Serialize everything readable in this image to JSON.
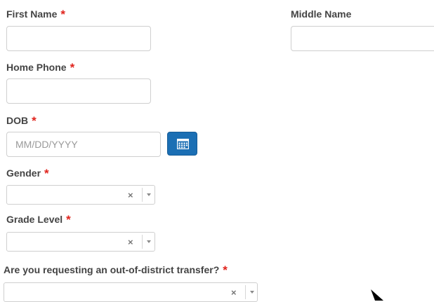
{
  "form": {
    "required_marker": "*",
    "first_name": {
      "label": "First Name",
      "value": ""
    },
    "middle_name": {
      "label": "Middle Name",
      "value": ""
    },
    "home_phone": {
      "label": "Home Phone",
      "value": ""
    },
    "dob": {
      "label": "DOB",
      "placeholder": "MM/DD/YYYY",
      "calendar_icon": "calendar-icon"
    },
    "gender": {
      "label": "Gender",
      "selected": "",
      "clear_glyph": "×"
    },
    "grade_level": {
      "label": "Grade Level",
      "selected": "",
      "clear_glyph": "×"
    },
    "transfer": {
      "label": "Are you requesting an out-of-district transfer?",
      "selected": "",
      "clear_glyph": "×"
    }
  },
  "colors": {
    "required": "#e0231c",
    "calendar_button": "#1b6fb4"
  }
}
